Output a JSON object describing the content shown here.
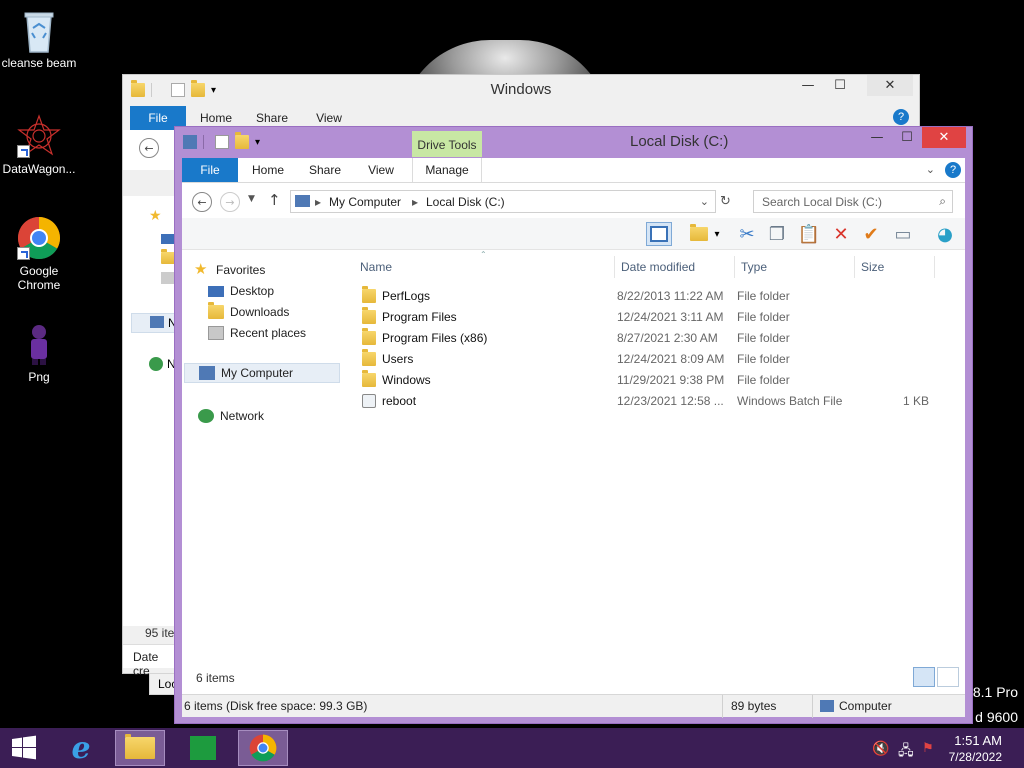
{
  "desktop": {
    "icons": [
      {
        "label": "cleanse beam"
      },
      {
        "label": "DataWagon..."
      },
      {
        "label": "Google Chrome"
      },
      {
        "label": "Png"
      }
    ],
    "watermark_line1": "8.1 Pro",
    "watermark_line2": "d 9600"
  },
  "back_window": {
    "title": "Windows",
    "tabs": [
      "File",
      "Home",
      "Share",
      "View"
    ],
    "partial_nav_1": "N",
    "partial_nav_2": "N",
    "partial_items": "95 ite",
    "partial_date": "Date cre",
    "partial_loc": "Loc"
  },
  "front_window": {
    "title": "Local Disk (C:)",
    "context_tab_header": "Drive Tools",
    "tabs": [
      "File",
      "Home",
      "Share",
      "View",
      "Manage"
    ],
    "breadcrumb": [
      "My Computer",
      "Local Disk (C:)"
    ],
    "search_placeholder": "Search Local Disk (C:)",
    "nav": {
      "favorites": "Favorites",
      "desktop": "Desktop",
      "downloads": "Downloads",
      "recent": "Recent places",
      "computer": "My Computer",
      "network": "Network"
    },
    "columns": [
      "Name",
      "Date modified",
      "Type",
      "Size"
    ],
    "files": [
      {
        "name": "PerfLogs",
        "date": "8/22/2013 11:22 AM",
        "type": "File folder",
        "size": "",
        "kind": "folder"
      },
      {
        "name": "Program Files",
        "date": "12/24/2021 3:11 AM",
        "type": "File folder",
        "size": "",
        "kind": "folder"
      },
      {
        "name": "Program Files (x86)",
        "date": "8/27/2021 2:30 AM",
        "type": "File folder",
        "size": "",
        "kind": "folder"
      },
      {
        "name": "Users",
        "date": "12/24/2021 8:09 AM",
        "type": "File folder",
        "size": "",
        "kind": "folder"
      },
      {
        "name": "Windows",
        "date": "11/29/2021 9:38 PM",
        "type": "File folder",
        "size": "",
        "kind": "folder"
      },
      {
        "name": "reboot",
        "date": "12/23/2021 12:58 ...",
        "type": "Windows Batch File",
        "size": "1 KB",
        "kind": "batch"
      }
    ],
    "items_count": "6 items",
    "status": {
      "left": "6 items (Disk free space: 99.3 GB)",
      "middle": "89 bytes",
      "right": "Computer"
    }
  },
  "taskbar": {
    "time": "1:51 AM",
    "date": "7/28/2022"
  },
  "colors": {
    "front_frame": "#b38fd4",
    "file_tab": "#1979ca",
    "drive_tools": "#c8e7a4",
    "taskbar": "#3b1e55",
    "close_red": "#e04343"
  }
}
